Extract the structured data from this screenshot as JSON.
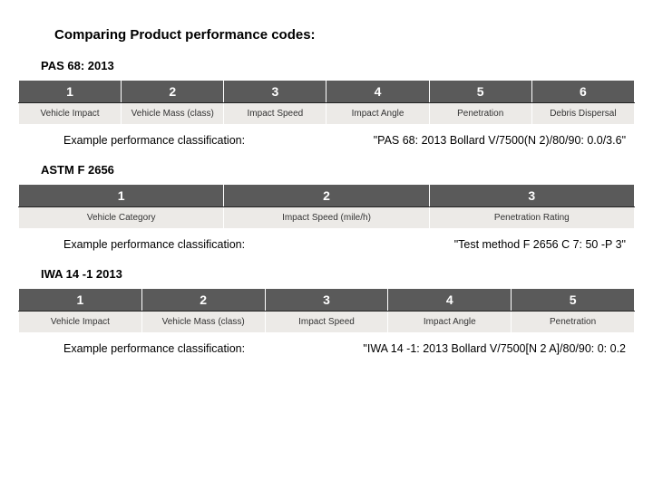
{
  "title": "Comparing Product performance codes:",
  "example_label": "Example performance classification:",
  "sections": [
    {
      "name": "PAS 68: 2013",
      "cols": [
        "1",
        "2",
        "3",
        "4",
        "5",
        "6"
      ],
      "desc": [
        "Vehicle Impact",
        "Vehicle Mass (class)",
        "Impact Speed",
        "Impact Angle",
        "Penetration",
        "Debris Dispersal"
      ],
      "example": "\"PAS 68: 2013 Bollard V/7500(N 2)/80/90: 0.0/3.6\""
    },
    {
      "name": "ASTM F 2656",
      "cols": [
        "1",
        "2",
        "3"
      ],
      "desc": [
        "Vehicle Category",
        "Impact Speed (mile/h)",
        "Penetration Rating"
      ],
      "example": "\"Test method F 2656 C 7: 50 -P 3\""
    },
    {
      "name": "IWA 14 -1 2013",
      "cols": [
        "1",
        "2",
        "3",
        "4",
        "5"
      ],
      "desc": [
        "Vehicle Impact",
        "Vehicle Mass (class)",
        "Impact Speed",
        "Impact Angle",
        "Penetration"
      ],
      "example": "\"IWA 14 -1: 2013 Bollard V/7500[N 2 A]/80/90: 0: 0.2"
    }
  ]
}
